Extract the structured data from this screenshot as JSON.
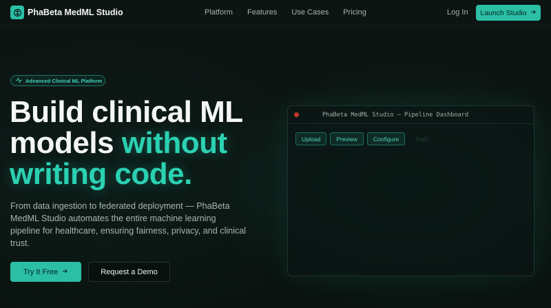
{
  "nav": {
    "brand": "PhaBeta MedML Studio",
    "links": [
      "Platform",
      "Features",
      "Use Cases",
      "Pricing"
    ],
    "login": "Log In",
    "launch": "Launch Studio"
  },
  "hero": {
    "badge": "Advanced Clinical ML Platform",
    "headline_line1": "Build clinical ML",
    "headline_line2_plain": "models ",
    "headline_line2_accent": "without",
    "headline_line3_accent": "writing code.",
    "subtext": "From data ingestion to federated deployment — PhaBeta MedML Studio automates the entire machine learning pipeline for healthcare, ensuring fairness, privacy, and clinical trust.",
    "try_button": "Try It Free",
    "demo_button": "Request a Demo"
  },
  "dashboard": {
    "title": "PhaBeta MedML Studio — Pipeline Dashboard",
    "tools": [
      "Upload",
      "Preview",
      "Configure",
      "Train"
    ]
  },
  "colors": {
    "accent": "#2bbfa6",
    "background": "#0b1412",
    "close_dot": "#c0392b"
  }
}
